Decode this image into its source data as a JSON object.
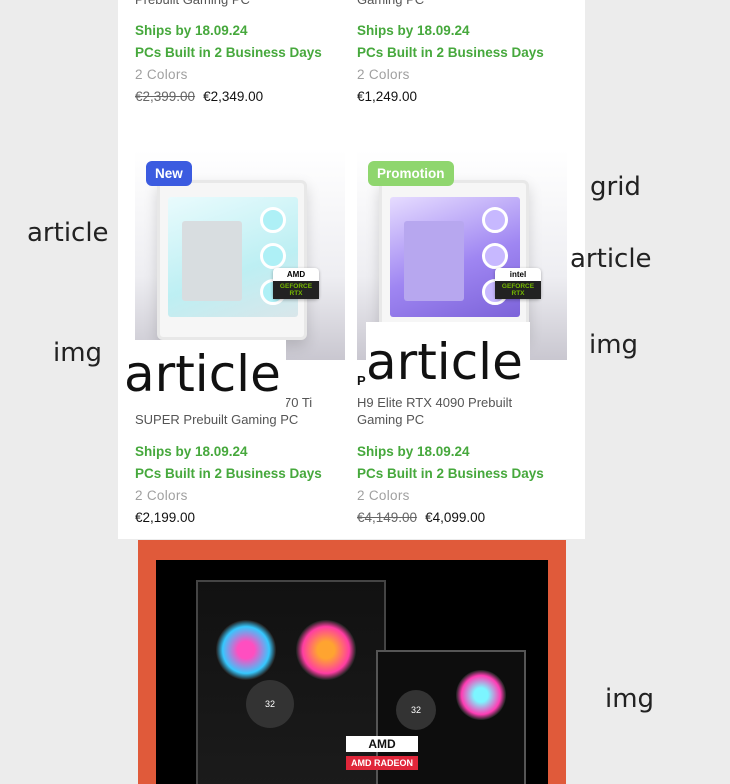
{
  "annotations": {
    "article_left": "article",
    "grid_right": "grid",
    "article_right": "article",
    "img_left": "img",
    "img_right": "img",
    "img_banner": "img",
    "article_overlay_1": "article",
    "article_overlay_2": "article"
  },
  "products": [
    {
      "name": "Prebuilt Gaming PC",
      "ship": "Ships by 18.09.24",
      "build": "PCs Built in 2 Business Days",
      "colors": "2 Colors",
      "old_price": "€2,399.00",
      "price": "€2,349.00"
    },
    {
      "name": "Gaming PC",
      "ship": "Ships by 18.09.24",
      "build": "PCs Built in 2 Business Days",
      "colors": "2 Colors",
      "old_price": "",
      "price": "€1,249.00"
    },
    {
      "badge": "New",
      "badge_color": "#3b5be0",
      "gpu_brand": "AMD",
      "gpu_series": "GEFORCE RTX",
      "name_line1": "70 Ti",
      "name_line2": "SUPER Prebuilt Gaming PC",
      "ship": "Ships by 18.09.24",
      "build": "PCs Built in 2 Business Days",
      "colors": "2 Colors",
      "old_price": "",
      "price": "€2,199.00"
    },
    {
      "badge": "Promotion",
      "badge_color": "#8fd66e",
      "gpu_brand": "intel",
      "gpu_series": "GEFORCE RTX",
      "name_prefix": "P",
      "name_line1": "H9 Elite RTX 4090 Prebuilt",
      "name_line2": "Gaming PC",
      "ship": "Ships by 18.09.24",
      "build": "PCs Built in 2 Business Days",
      "colors": "2 Colors",
      "old_price": "€4,149.00",
      "price": "€4,099.00"
    }
  ],
  "banner": {
    "fan_label_1": "32",
    "fan_label_2": "32",
    "logo_1": "AMD",
    "logo_2": "AMD RADEON"
  },
  "colors": {
    "ship_green": "#46a83c",
    "banner_orange": "#e05a3a"
  }
}
